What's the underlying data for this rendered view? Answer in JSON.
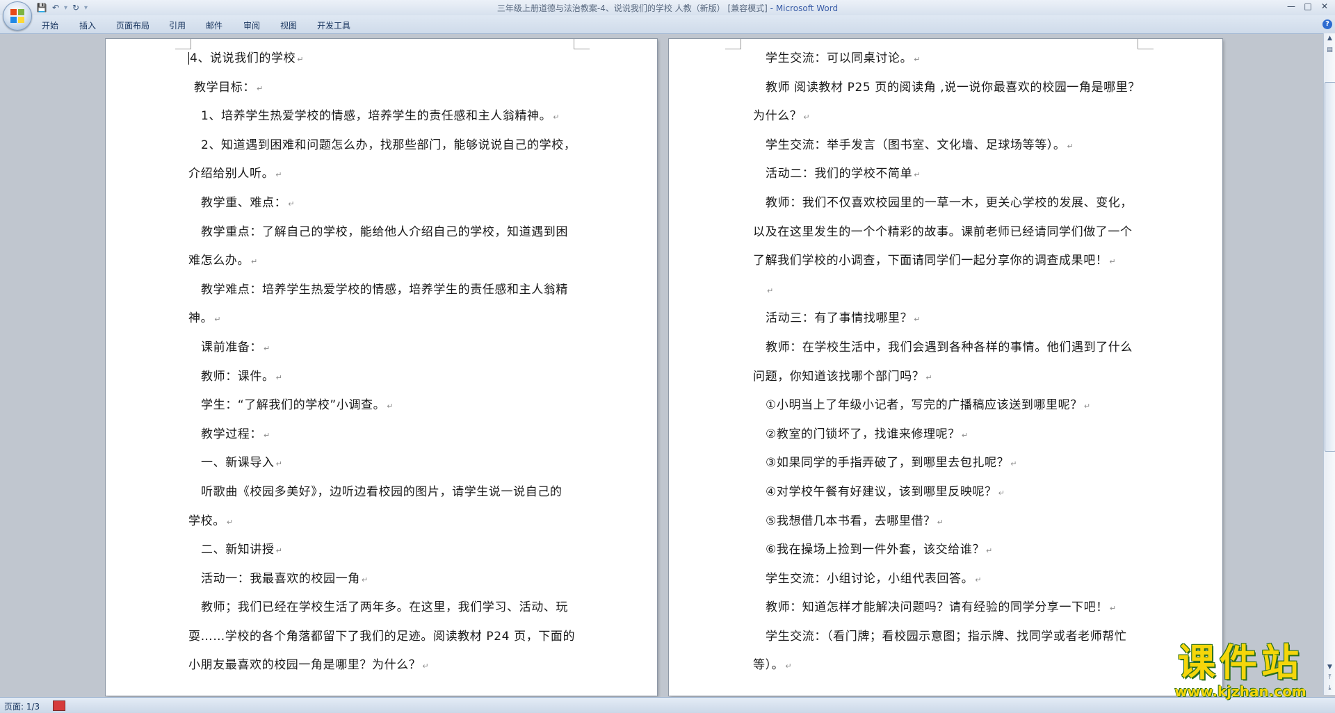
{
  "window": {
    "title": "三年级上册道德与法治教案-4、说说我们的学校 人教（新版） [兼容模式]",
    "app_suffix": " - Microsoft Word",
    "controls": [
      "—",
      "□",
      "✕"
    ]
  },
  "quick_access": {
    "save_icon": "save-icon",
    "undo_icon": "undo-icon",
    "redo_icon": "redo-icon",
    "customize": "▾"
  },
  "ribbon_tabs": [
    "开始",
    "插入",
    "页面布局",
    "引用",
    "邮件",
    "审阅",
    "视图",
    "开发工具"
  ],
  "help_label": "?",
  "colors": {
    "accent": "#2d6bd0",
    "paragraph_mark": "#8a8a8a",
    "watermark": "#f5d60a"
  },
  "paragraph_mark": "↵",
  "left_page": {
    "lines": [
      {
        "text": "4、说说我们的学校",
        "mark": true,
        "indent": "none",
        "cursor": true
      },
      {
        "text": "教学目标：",
        "mark": true,
        "indent": "small"
      },
      {
        "text": "1、培养学生热爱学校的情感，培养学生的责任感和主人翁精神。",
        "mark": true,
        "indent": "para"
      },
      {
        "text": "2、知道遇到困难和问题怎么办，找那些部门，能够说说自己的学校，",
        "mark": false,
        "indent": "para"
      },
      {
        "text": "介绍给别人听。",
        "mark": true,
        "indent": "none"
      },
      {
        "text": "教学重、难点：",
        "mark": true,
        "indent": "para"
      },
      {
        "text": "教学重点：了解自己的学校，能给他人介绍自己的学校，知道遇到困",
        "mark": false,
        "indent": "para"
      },
      {
        "text": "难怎么办。",
        "mark": true,
        "indent": "none"
      },
      {
        "text": "教学难点：培养学生热爱学校的情感，培养学生的责任感和主人翁精",
        "mark": false,
        "indent": "para"
      },
      {
        "text": "神。",
        "mark": true,
        "indent": "none"
      },
      {
        "text": "课前准备：",
        "mark": true,
        "indent": "para"
      },
      {
        "text": "教师：课件。",
        "mark": true,
        "indent": "para"
      },
      {
        "text": "学生：“了解我们的学校”小调查。",
        "mark": true,
        "indent": "para"
      },
      {
        "text": "教学过程：",
        "mark": true,
        "indent": "para"
      },
      {
        "text": "一、新课导入",
        "mark": true,
        "indent": "para"
      },
      {
        "text": "听歌曲《校园多美好》，边听边看校园的图片，请学生说一说自己的",
        "mark": false,
        "indent": "para"
      },
      {
        "text": "学校。",
        "mark": true,
        "indent": "none"
      },
      {
        "text": "二、新知讲授",
        "mark": true,
        "indent": "para"
      },
      {
        "text": "活动一：我最喜欢的校园一角",
        "mark": true,
        "indent": "para"
      },
      {
        "text": "教师；我们已经在学校生活了两年多。在这里，我们学习、活动、玩",
        "mark": false,
        "indent": "para"
      },
      {
        "text": "耍……学校的各个角落都留下了我们的足迹。阅读教材 P24 页，下面的",
        "mark": false,
        "indent": "none"
      },
      {
        "text": "小朋友最喜欢的校园一角是哪里？为什么？",
        "mark": true,
        "indent": "none"
      }
    ]
  },
  "right_page": {
    "lines": [
      {
        "text": "学生交流：可以同桌讨论。",
        "mark": true,
        "indent": "para"
      },
      {
        "text": "教师 阅读教材 P25 页的阅读角 ,说一说你最喜欢的校园一角是哪里？",
        "mark": false,
        "indent": "para"
      },
      {
        "text": "为什么？",
        "mark": true,
        "indent": "none"
      },
      {
        "text": "学生交流：举手发言（图书室、文化墙、足球场等等）。",
        "mark": true,
        "indent": "para"
      },
      {
        "text": "活动二：我们的学校不简单",
        "mark": true,
        "indent": "para"
      },
      {
        "text": "教师：我们不仅喜欢校园里的一草一木，更关心学校的发展、变化，",
        "mark": false,
        "indent": "para"
      },
      {
        "text": "以及在这里发生的一个个精彩的故事。课前老师已经请同学们做了一个",
        "mark": false,
        "indent": "none"
      },
      {
        "text": "了解我们学校的小调查，下面请同学们一起分享你的调查成果吧！",
        "mark": true,
        "indent": "none"
      },
      {
        "text": "",
        "mark": true,
        "indent": "para"
      },
      {
        "text": "活动三：有了事情找哪里？",
        "mark": true,
        "indent": "para"
      },
      {
        "text": "教师：在学校生活中，我们会遇到各种各样的事情。他们遇到了什么",
        "mark": false,
        "indent": "para"
      },
      {
        "text": "问题，你知道该找哪个部门吗？",
        "mark": true,
        "indent": "none"
      },
      {
        "text": "①小明当上了年级小记者，写完的广播稿应该送到哪里呢？",
        "mark": true,
        "indent": "para"
      },
      {
        "text": "②教室的门锁坏了，找谁来修理呢？",
        "mark": true,
        "indent": "para"
      },
      {
        "text": "③如果同学的手指弄破了，到哪里去包扎呢？",
        "mark": true,
        "indent": "para"
      },
      {
        "text": "④对学校午餐有好建议，该到哪里反映呢？",
        "mark": true,
        "indent": "para"
      },
      {
        "text": "⑤我想借几本书看，去哪里借？",
        "mark": true,
        "indent": "para"
      },
      {
        "text": "⑥我在操场上捡到一件外套，该交给谁？",
        "mark": true,
        "indent": "para"
      },
      {
        "text": "学生交流：小组讨论，小组代表回答。",
        "mark": true,
        "indent": "para"
      },
      {
        "text": "教师：知道怎样才能解决问题吗？请有经验的同学分享一下吧！",
        "mark": true,
        "indent": "para"
      },
      {
        "text": "学生交流：（看门牌；看校园示意图；指示牌、找同学或者老师帮忙",
        "mark": false,
        "indent": "para"
      },
      {
        "text": "等）。",
        "mark": true,
        "indent": "none"
      }
    ]
  },
  "status": {
    "page": "页面: 1/3"
  },
  "watermark": {
    "name": "课件站",
    "url": "www.kjzhan.com"
  }
}
